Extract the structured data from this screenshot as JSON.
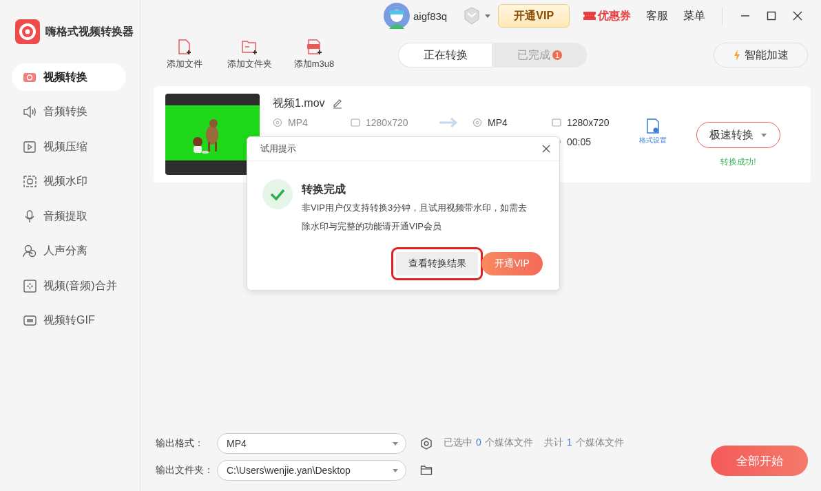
{
  "app": {
    "title": "嗨格式视频转换器"
  },
  "sidebar": {
    "items": [
      {
        "label": "视频转换",
        "selected": true
      },
      {
        "label": "音频转换",
        "selected": false
      },
      {
        "label": "视频压缩",
        "selected": false
      },
      {
        "label": "视频水印",
        "selected": false
      },
      {
        "label": "音频提取",
        "selected": false
      },
      {
        "label": "人声分离",
        "selected": false
      },
      {
        "label": "视频(音频)合并",
        "selected": false
      },
      {
        "label": "视频转GIF",
        "selected": false
      }
    ]
  },
  "topbar": {
    "username": "aigf83q",
    "vip_button": "开通VIP",
    "coupon": "优惠券",
    "support": "客服",
    "menu": "菜单"
  },
  "toolbar": {
    "buttons": [
      {
        "label": "添加文件",
        "kind": "file"
      },
      {
        "label": "添加文件夹",
        "kind": "folder"
      },
      {
        "label": "添加m3u8",
        "kind": "m3u8"
      }
    ]
  },
  "tabs": [
    {
      "label": "正在转换",
      "selected": true
    },
    {
      "label": "已完成",
      "selected": false,
      "badge": "1"
    }
  ],
  "speed_button": "智能加速",
  "file": {
    "name": "视频1.mov",
    "source": {
      "format": "MP4",
      "resolution": "1280x720"
    },
    "output": {
      "format": "MP4",
      "resolution": "1280x720",
      "duration": "00:05"
    },
    "format_settings": "格式设置",
    "convert_button": "极速转换",
    "status": "转换成功!"
  },
  "dialog": {
    "title": "试用提示",
    "heading": "转换完成",
    "message": "非VIP用户仅支持转换3分钟，且试用视频带水印，如需去除水印与完整的功能请开通VIP会员",
    "buttons": [
      {
        "label": "查看转换结果",
        "kind": "secondary",
        "highlighted": true
      },
      {
        "label": "开通VIP",
        "kind": "primary",
        "highlighted": false
      }
    ]
  },
  "footer": {
    "format_label": "输出格式：",
    "format_value": "MP4",
    "folder_label": "输出文件夹：",
    "folder_value": "C:\\Users\\wenjie.yan\\Desktop",
    "selected_summary": {
      "prefix": "已选中",
      "count": "0",
      "suffix": "个媒体文件"
    },
    "total_summary": {
      "prefix": "共计",
      "count": "1",
      "suffix": "个媒体文件"
    },
    "start_button": "全部开始"
  }
}
